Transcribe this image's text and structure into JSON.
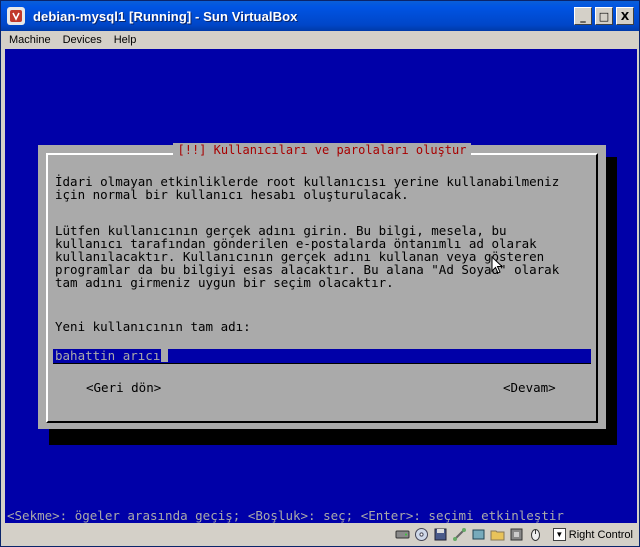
{
  "window": {
    "title": "debian-mysql1 [Running] - Sun VirtualBox",
    "controls": {
      "minimize": "_",
      "maximize": "□",
      "close": "X"
    }
  },
  "menubar": {
    "items": [
      "Machine",
      "Devices",
      "Help"
    ]
  },
  "dialog": {
    "title": "[!!] Kullanıcıları ve parolaları oluştur",
    "paragraph1": "İdari olmayan etkinliklerde root kullanıcısı yerine kullanabilmeniz\niçin normal bir kullanıcı hesabı oluşturulacak.",
    "paragraph2": "Lütfen kullanıcının gerçek adını girin. Bu bilgi, mesela, bu\nkullanıcı tarafından gönderilen e-postalarda öntanımlı ad olarak\nkullanılacaktır. Kullanıcının gerçek adını kullanan veya gösteren\nprogramlar da bu bilgiyi esas alacaktır. Bu alana \"Ad Soyad\" olarak\ntam adını girmeniz uygun bir seçim olacaktır.",
    "prompt": "Yeni kullanıcının tam adı:",
    "input_value": "bahattin arıcı",
    "back_button": "<Geri dön>",
    "continue_button": "<Devam>"
  },
  "help_bar": "<Sekme>: ögeler arasında geçiş; <Boşluk>: seç; <Enter>: seçimi etkinleştir",
  "statusbar": {
    "icons": [
      "hard-disk-icon",
      "cd-icon",
      "floppy-icon",
      "network-icon",
      "usb-icon",
      "shared-folders-icon",
      "virtualization-icon",
      "mouse-integration-icon"
    ],
    "host_key": "Right Control"
  },
  "colors": {
    "titlebar": "#0054e3",
    "vm_background": "#0000a8",
    "dialog_gray": "#aaaaaa",
    "dialog_title_red": "#a80000"
  }
}
